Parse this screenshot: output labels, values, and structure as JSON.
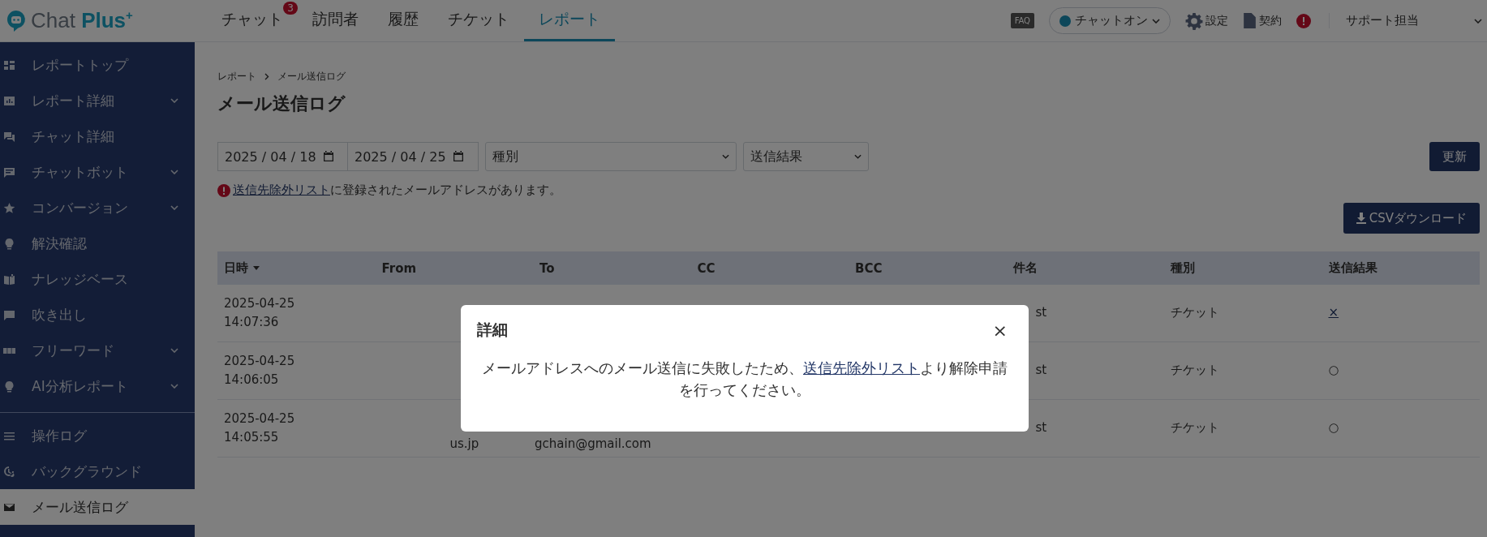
{
  "header": {
    "logo": {
      "text": "Chat",
      "accent": "Plus",
      "sup": "+"
    },
    "tabs": [
      {
        "label": "チャット",
        "selected": false,
        "badge": "3"
      },
      {
        "label": "訪問者",
        "selected": false
      },
      {
        "label": "履歴",
        "selected": false
      },
      {
        "label": "チケット",
        "selected": false
      },
      {
        "label": "レポート",
        "selected": true
      }
    ],
    "faq": "FAQ",
    "status": {
      "label": "チャットオン",
      "on": true
    },
    "settings": "設定",
    "contract": "契約",
    "user": "サポート担当"
  },
  "sidebar": {
    "items": [
      {
        "label": "レポートトップ",
        "expandable": false,
        "selected": false
      },
      {
        "label": "レポート詳細",
        "expandable": true,
        "selected": false
      },
      {
        "label": "チャット詳細",
        "expandable": false,
        "selected": false
      },
      {
        "label": "チャットボット",
        "expandable": true,
        "selected": false
      },
      {
        "label": "コンバージョン",
        "expandable": true,
        "selected": false
      },
      {
        "label": "解決確認",
        "expandable": false,
        "selected": false
      },
      {
        "label": "ナレッジベース",
        "expandable": false,
        "selected": false
      },
      {
        "label": "吹き出し",
        "expandable": false,
        "selected": false
      },
      {
        "label": "フリーワード",
        "expandable": true,
        "selected": false
      },
      {
        "label": "AI分析レポート",
        "expandable": true,
        "selected": false
      }
    ],
    "tools": [
      {
        "label": "操作ログ",
        "selected": false
      },
      {
        "label": "バックグラウンド",
        "selected": false
      },
      {
        "label": "メール送信ログ",
        "selected": true
      }
    ]
  },
  "breadcrumb": [
    "レポート",
    "メール送信ログ"
  ],
  "title": "メール送信ログ",
  "filters": {
    "date_from": "2025 / 04 / 18",
    "date_to": "2025 / 04 / 25",
    "type": "種別",
    "result": "送信結果",
    "refresh": "更新"
  },
  "warning": {
    "link": "送信先除外リスト",
    "text": "に登録されたメールアドレスがあります。"
  },
  "csv_button": "CSVダウンロード",
  "table": {
    "columns": [
      {
        "label": "日時",
        "sorted": true
      },
      {
        "label": "From",
        "sorted": false
      },
      {
        "label": "To",
        "sorted": false
      },
      {
        "label": "CC",
        "sorted": false
      },
      {
        "label": "BCC",
        "sorted": false
      },
      {
        "label": "件名",
        "sorted": false
      },
      {
        "label": "種別",
        "sorted": false
      },
      {
        "label": "送信結果",
        "sorted": false
      }
    ],
    "rows": [
      {
        "date": "2025-04-25",
        "time": "14:07:36",
        "from": "",
        "to": "",
        "subject": "st",
        "type": "チケット",
        "result": "×",
        "failed": true
      },
      {
        "date": "2025-04-25",
        "time": "14:06:05",
        "from": "",
        "to": "",
        "subject": "st",
        "type": "チケット",
        "result": "○",
        "failed": false
      },
      {
        "date": "2025-04-25",
        "time": "14:05:55",
        "from": "us.jp",
        "to": "gchain@gmail.com",
        "subject": "st",
        "type": "チケット",
        "result": "○",
        "failed": false
      }
    ]
  },
  "modal": {
    "title": "詳細",
    "close": "×",
    "before": "メールアドレスへのメール送信に失敗したため、",
    "link": "送信先除外リスト",
    "after": "より解除申請を行ってください。"
  }
}
